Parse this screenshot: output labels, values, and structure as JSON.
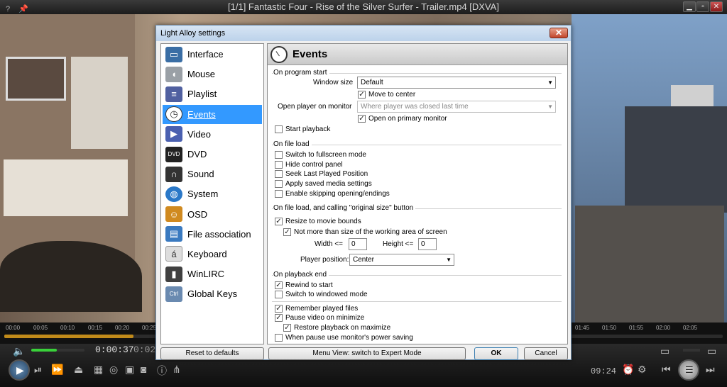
{
  "player": {
    "title": "[1/1] Fantastic Four - Rise of the Silver Surfer - Trailer.mp4  [DXVA]",
    "help_icon": "?",
    "time_elapsed": "0:00:37",
    "time_total_partial": "0:02",
    "clock": "09:24",
    "timeline_ticks_left": [
      "00:00",
      "00:05",
      "00:10",
      "00:15",
      "00:20",
      "00:25"
    ],
    "timeline_ticks_right": [
      "01:45",
      "01:50",
      "01:55",
      "02:00",
      "02:05"
    ],
    "progress": 0.18
  },
  "dialog": {
    "title": "Light Alloy settings",
    "close_label": "✕",
    "nav": [
      {
        "label": "Interface",
        "icon": "monitor-icon",
        "color": "#3a6ea5"
      },
      {
        "label": "Mouse",
        "icon": "mouse-icon",
        "color": "#9aa0a6"
      },
      {
        "label": "Playlist",
        "icon": "playlist-icon",
        "color": "#5060a0"
      },
      {
        "label": "Events",
        "icon": "clock-icon",
        "color": "#ffffff"
      },
      {
        "label": "Video",
        "icon": "video-icon",
        "color": "#4a60b0"
      },
      {
        "label": "DVD",
        "icon": "dvd-icon",
        "color": "#222222"
      },
      {
        "label": "Sound",
        "icon": "headphones-icon",
        "color": "#333333"
      },
      {
        "label": "System",
        "icon": "globe-icon",
        "color": "#2a78c8"
      },
      {
        "label": "OSD",
        "icon": "user-icon",
        "color": "#d08a20"
      },
      {
        "label": "File association",
        "icon": "film-icon",
        "color": "#3a7ac0"
      },
      {
        "label": "Keyboard",
        "icon": "key-icon",
        "color": "#cccccc"
      },
      {
        "label": "WinLIRC",
        "icon": "remote-icon",
        "color": "#404040"
      },
      {
        "label": "Global Keys",
        "icon": "keys-icon",
        "color": "#6a8ab0"
      }
    ],
    "selected": "Events",
    "panel_title": "Events",
    "on_start": {
      "legend": "On program start",
      "window_size_label": "Window size",
      "window_size_value": "Default",
      "move_to_center": "Move to center",
      "open_on_monitor_label": "Open player on monitor",
      "open_on_monitor_value": "Where player was closed last time",
      "open_primary": "Open on primary monitor",
      "start_playback": "Start playback"
    },
    "on_load": {
      "legend": "On file load",
      "items": [
        "Switch to fullscreen mode",
        "Hide control panel",
        "Seek Last Played Position",
        "Apply saved media settings",
        "Enable skipping opening/endings"
      ]
    },
    "orig_size": {
      "legend": "On file load, and calling \"original size\" button",
      "resize": "Resize to movie bounds",
      "not_more": "Not more than size of the working area of screen",
      "width_label": "Width <=",
      "width_value": "0",
      "height_label": "Height <=",
      "height_value": "0",
      "position_label": "Player position:",
      "position_value": "Center"
    },
    "on_end": {
      "legend": "On playback end",
      "rewind": "Rewind to start",
      "windowed": "Switch to windowed mode"
    },
    "misc": {
      "remember": "Remember played files",
      "pause_min": "Pause video on minimize",
      "restore": "Restore playback on maximize",
      "power": "When pause use monitor's power saving"
    },
    "buttons": {
      "reset": "Reset to defaults",
      "menu_view": "Menu View: switch to Expert Mode",
      "ok": "OK",
      "cancel": "Cancel"
    }
  }
}
